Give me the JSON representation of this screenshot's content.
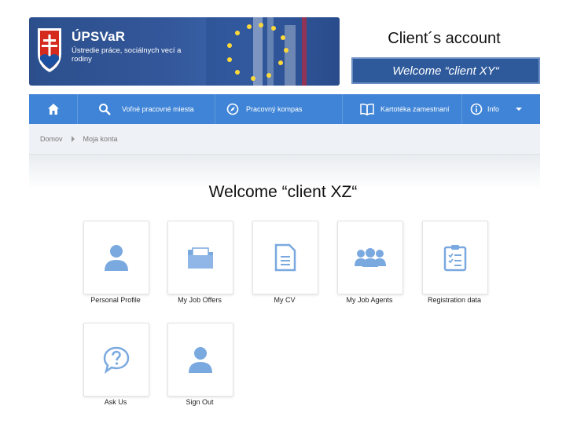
{
  "header": {
    "brand": "ÚPSVaR",
    "subtitle": "Ústredie práce, sociálnych vecí a rodiny",
    "account_title": "Client´s account",
    "welcome_box": "Welcome “client XY“"
  },
  "nav": {
    "items": [
      {
        "label": "Voľné pracovné miesta",
        "icon": "search-icon"
      },
      {
        "label": "Pracovný kompas",
        "icon": "compass-icon"
      },
      {
        "label": "Kartotéka zamestnaní",
        "icon": "book-icon"
      },
      {
        "label": "Info",
        "icon": "info-icon"
      }
    ]
  },
  "breadcrumb": [
    "Domov",
    "Moja konta"
  ],
  "main": {
    "title": "Welcome “client XZ“",
    "tiles": [
      {
        "label": "Personal Profile",
        "icon": "user-icon"
      },
      {
        "label": "My Job Offers",
        "icon": "folder-icon"
      },
      {
        "label": "My CV",
        "icon": "document-icon"
      },
      {
        "label": "My Job Agents",
        "icon": "group-icon"
      },
      {
        "label": "Registration data",
        "icon": "clipboard-icon"
      },
      {
        "label": "Ask Us",
        "icon": "question-bubble-icon"
      },
      {
        "label": "Sign Out",
        "icon": "user-icon"
      }
    ]
  },
  "colors": {
    "nav_bg": "#3f84d6",
    "banner_bg": "#2c4f8c",
    "tile_icon": "#7aa9e0"
  }
}
